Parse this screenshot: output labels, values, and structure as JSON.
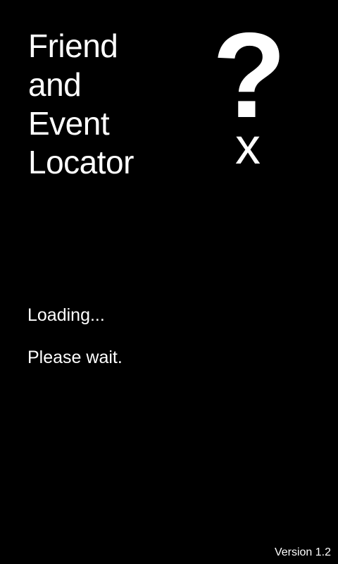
{
  "app": {
    "title_lines": [
      "Friend",
      "and",
      "Event",
      "Locator"
    ],
    "logo": {
      "icon": "question-mark-icon",
      "glyph": "?",
      "sub_glyph": "x"
    }
  },
  "status": {
    "loading": "Loading...",
    "wait": "Please wait."
  },
  "footer": {
    "version": "Version 1.2"
  },
  "colors": {
    "background": "#000000",
    "text": "#ffffff"
  }
}
